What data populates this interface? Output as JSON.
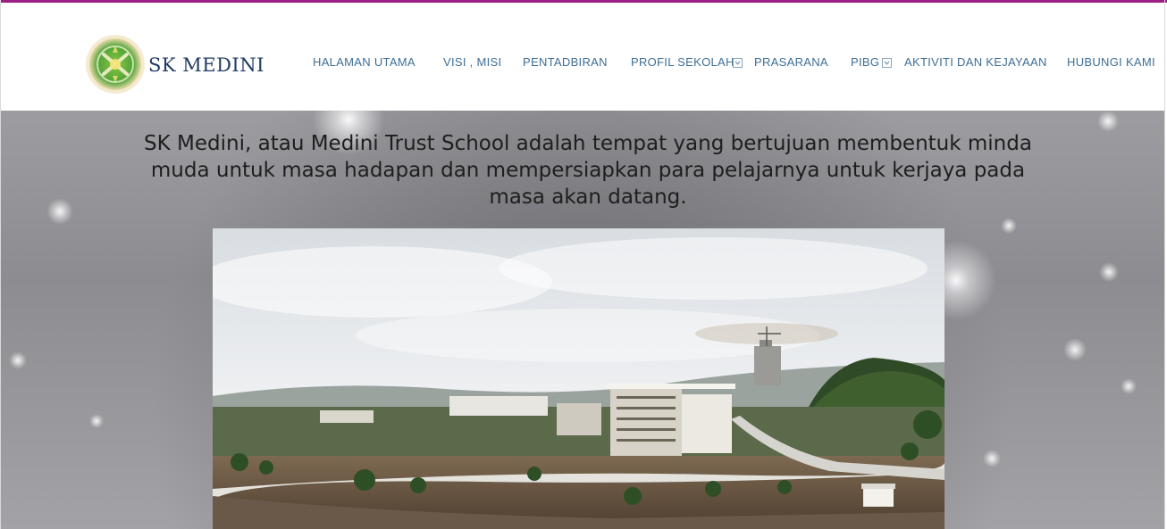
{
  "brand": {
    "name": "SK MEDINI",
    "logo_icon": "school-crest-icon",
    "accent_color": "#9b1f86"
  },
  "nav": {
    "items": [
      {
        "label": "HALAMAN UTAMA"
      },
      {
        "label": "VISI , MISI"
      },
      {
        "label": "PENTADBIRAN"
      },
      {
        "label": "PROFIL SEKOLAH",
        "dropdown_icon": "chevron-down-icon"
      },
      {
        "label": "PRASARANA"
      },
      {
        "label": "PIBG",
        "dropdown_icon": "chevron-down-icon"
      },
      {
        "label": "AKTIVITI DAN KEJAYAAN"
      },
      {
        "label": "HUBUNGI KAMI"
      }
    ],
    "text_color": "#3d6e96"
  },
  "hero": {
    "tagline": "SK Medini, atau Medini Trust School adalah tempat yang bertujuan membentuk minda muda untuk masa hadapan dan mempersiapkan para pelajarnya untuk kerjaya pada masa akan datang.",
    "image_icon": "campus-panorama-image"
  }
}
